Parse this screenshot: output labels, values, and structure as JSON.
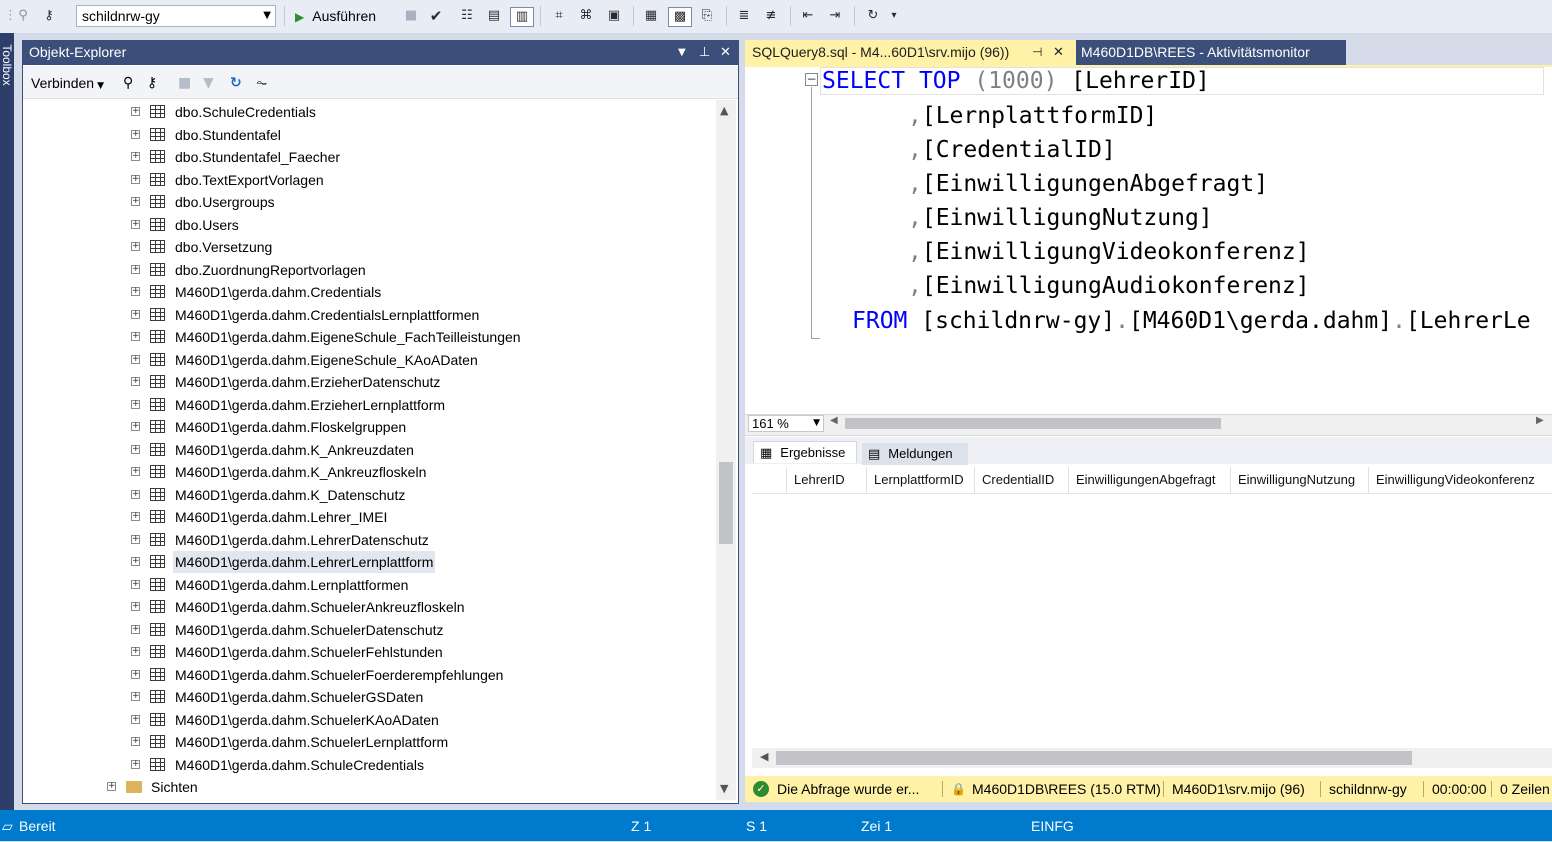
{
  "toolbar": {
    "database": "schildnrw-gy",
    "run_label": "Ausführen",
    "icons": [
      "connect-icon",
      "disconnect-icon",
      "run-icon",
      "stop-icon",
      "parse-icon",
      "plan-icon",
      "results-text-icon",
      "results-grid-icon",
      "results-file-icon",
      "comment-icon",
      "uncomment-icon",
      "indent-icon",
      "outdent-icon",
      "specify-values-icon"
    ]
  },
  "toolbox": {
    "label": "Toolbox"
  },
  "object_explorer": {
    "title": "Objekt-Explorer",
    "connect_label": "Verbinden",
    "tree": [
      {
        "label": "dbo.SchuleCredentials",
        "type": "table"
      },
      {
        "label": "dbo.Stundentafel",
        "type": "table"
      },
      {
        "label": "dbo.Stundentafel_Faecher",
        "type": "table"
      },
      {
        "label": "dbo.TextExportVorlagen",
        "type": "table"
      },
      {
        "label": "dbo.Usergroups",
        "type": "table"
      },
      {
        "label": "dbo.Users",
        "type": "table"
      },
      {
        "label": "dbo.Versetzung",
        "type": "table"
      },
      {
        "label": "dbo.ZuordnungReportvorlagen",
        "type": "table"
      },
      {
        "label": "M460D1\\gerda.dahm.Credentials",
        "type": "table"
      },
      {
        "label": "M460D1\\gerda.dahm.CredentialsLernplattformen",
        "type": "table"
      },
      {
        "label": "M460D1\\gerda.dahm.EigeneSchule_FachTeilleistungen",
        "type": "table"
      },
      {
        "label": "M460D1\\gerda.dahm.EigeneSchule_KAoADaten",
        "type": "table"
      },
      {
        "label": "M460D1\\gerda.dahm.ErzieherDatenschutz",
        "type": "table"
      },
      {
        "label": "M460D1\\gerda.dahm.ErzieherLernplattform",
        "type": "table"
      },
      {
        "label": "M460D1\\gerda.dahm.Floskelgruppen",
        "type": "table"
      },
      {
        "label": "M460D1\\gerda.dahm.K_Ankreuzdaten",
        "type": "table"
      },
      {
        "label": "M460D1\\gerda.dahm.K_Ankreuzfloskeln",
        "type": "table"
      },
      {
        "label": "M460D1\\gerda.dahm.K_Datenschutz",
        "type": "table"
      },
      {
        "label": "M460D1\\gerda.dahm.Lehrer_IMEI",
        "type": "table"
      },
      {
        "label": "M460D1\\gerda.dahm.LehrerDatenschutz",
        "type": "table"
      },
      {
        "label": "M460D1\\gerda.dahm.LehrerLernplattform",
        "type": "table",
        "selected": true
      },
      {
        "label": "M460D1\\gerda.dahm.Lernplattformen",
        "type": "table"
      },
      {
        "label": "M460D1\\gerda.dahm.SchuelerAnkreuzfloskeln",
        "type": "table"
      },
      {
        "label": "M460D1\\gerda.dahm.SchuelerDatenschutz",
        "type": "table"
      },
      {
        "label": "M460D1\\gerda.dahm.SchuelerFehlstunden",
        "type": "table"
      },
      {
        "label": "M460D1\\gerda.dahm.SchuelerFoerderempfehlungen",
        "type": "table"
      },
      {
        "label": "M460D1\\gerda.dahm.SchuelerGSDaten",
        "type": "table"
      },
      {
        "label": "M460D1\\gerda.dahm.SchuelerKAoADaten",
        "type": "table"
      },
      {
        "label": "M460D1\\gerda.dahm.SchuelerLernplattform",
        "type": "table"
      },
      {
        "label": "M460D1\\gerda.dahm.SchuleCredentials",
        "type": "table"
      },
      {
        "label": "Sichten",
        "type": "folder"
      }
    ]
  },
  "tabs": [
    {
      "label": "SQLQuery8.sql - M4...60D1\\srv.mijo (96))",
      "active": true
    },
    {
      "label": "M460D1DB\\REES - Aktivitätsmonitor",
      "active": false
    }
  ],
  "editor": {
    "line1": {
      "kw1": "SELECT",
      "kw2": "TOP",
      "paren": "(1000)",
      "rest": " [LehrerID]"
    },
    "columns": [
      "[LernplattformID]",
      "[CredentialID]",
      "[EinwilligungenAbgefragt]",
      "[EinwilligungNutzung]",
      "[EinwilligungVideokonferenz]",
      "[EinwilligungAudiokonferenz]"
    ],
    "from_kw": "FROM",
    "from_parts": [
      "[schildnrw-gy]",
      "[M460D1\\gerda.dahm]",
      "[LehrerLe"
    ]
  },
  "zoom": "161 %",
  "results": {
    "tabs": [
      "Ergebnisse",
      "Meldungen"
    ],
    "columns": [
      "LehrerID",
      "LernplattformID",
      "CredentialID",
      "EinwilligungenAbgefragt",
      "EinwilligungNutzung",
      "EinwilligungVideokonferenz"
    ]
  },
  "query_status": {
    "message": "Die Abfrage wurde er...",
    "server": "M460D1DB\\REES (15.0 RTM)",
    "user": "M460D1\\srv.mijo (96)",
    "database": "schildnrw-gy",
    "time": "00:00:00",
    "rows": "0 Zeilen"
  },
  "status_bar": {
    "ready": "Bereit",
    "row": "Z 1",
    "col": "S 1",
    "char": "Zei 1",
    "mode": "EINFG"
  },
  "colors": {
    "accent": "#007acc",
    "panel_title": "#3c4e7a",
    "active_tab": "#fff1a6",
    "keyword": "#0000ff"
  }
}
